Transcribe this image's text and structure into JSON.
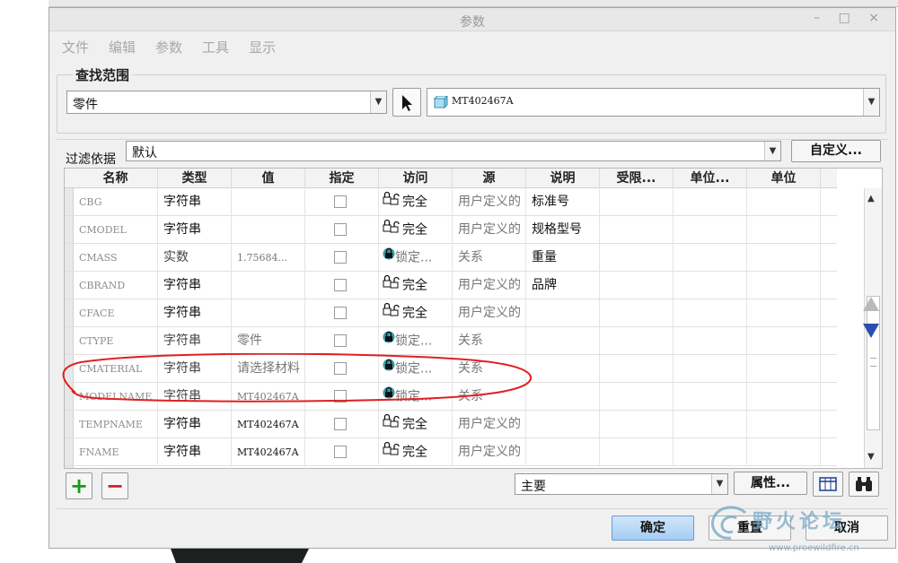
{
  "window": {
    "title": "参数",
    "controls": "– □ ×"
  },
  "menu": [
    "文件",
    "编辑",
    "参数",
    "工具",
    "显示"
  ],
  "scope": {
    "label": "查找范围",
    "type_value": "零件",
    "model_value": "MT402467A"
  },
  "filter": {
    "label": "过滤依据",
    "value": "默认",
    "custom_button": "自定义..."
  },
  "table": {
    "columns": [
      "名称",
      "类型",
      "值",
      "指定",
      "访问",
      "源",
      "说明",
      "受限...",
      "单位...",
      "单位"
    ],
    "rows": [
      {
        "name": "CBG",
        "type": "字符串",
        "value": "",
        "access": "完全",
        "access_icon": "unlock-icon",
        "source": "用户定义的",
        "desc": "标准号"
      },
      {
        "name": "CMODEL",
        "type": "字符串",
        "value": "",
        "access": "完全",
        "access_icon": "unlock-icon",
        "source": "用户定义的",
        "desc": "规格型号"
      },
      {
        "name": "CMASS",
        "type": "实数",
        "value": "1.75684...",
        "access": "锁定...",
        "access_icon": "lock-icon",
        "source": "关系",
        "desc": "重量"
      },
      {
        "name": "CBRAND",
        "type": "字符串",
        "value": "",
        "access": "完全",
        "access_icon": "unlock-icon",
        "source": "用户定义的",
        "desc": "品牌"
      },
      {
        "name": "CFACE",
        "type": "字符串",
        "value": "",
        "access": "完全",
        "access_icon": "unlock-icon",
        "source": "用户定义的",
        "desc": ""
      },
      {
        "name": "CTYPE",
        "type": "字符串",
        "value": "零件",
        "access": "锁定...",
        "access_icon": "lock-icon",
        "source": "关系",
        "desc": ""
      },
      {
        "name": "CMATERIAL",
        "type": "字符串",
        "value": "请选择材料",
        "access": "锁定...",
        "access_icon": "lock-icon",
        "source": "关系",
        "desc": ""
      },
      {
        "name": "MODELNAME",
        "type": "字符串",
        "value": "MT402467A",
        "access": "锁定...",
        "access_icon": "lock-icon",
        "source": "关系",
        "desc": ""
      },
      {
        "name": "TEMPNAME",
        "type": "字符串",
        "value": "MT402467A",
        "access": "完全",
        "access_icon": "unlock-icon",
        "source": "用户定义的",
        "desc": ""
      },
      {
        "name": "FNAME",
        "type": "字符串",
        "value": "MT402467A",
        "access": "完全",
        "access_icon": "unlock-icon",
        "source": "用户定义的",
        "desc": ""
      }
    ]
  },
  "bottom": {
    "add_symbol": "+",
    "remove_symbol": "−",
    "view_value": "主要",
    "properties_button": "属性...",
    "ok_button": "确定",
    "reset_button": "重置",
    "cancel_button": "取消"
  },
  "watermark": {
    "text": "野火论坛",
    "url": "www.proewildfire.cn"
  },
  "colors": {
    "accent_blue": "#2b4fb0",
    "ok_button": "#a6cdf2",
    "annotation_red": "#e02020",
    "add_green": "#1a9a1a",
    "remove_red": "#d42020"
  }
}
